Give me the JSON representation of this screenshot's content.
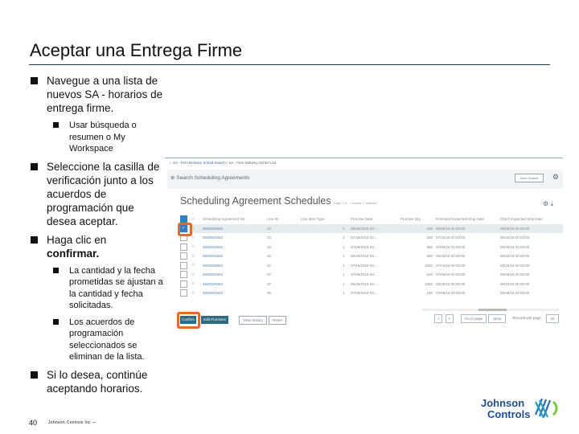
{
  "slide": {
    "title": "Aceptar una Entrega Firme",
    "page_number": "40",
    "footer": "Johnson Controls Inc —",
    "brand": {
      "line1": "Johnson",
      "line2": "Controls",
      "color": "#1f4e8c"
    },
    "rule_color": "#1f3550",
    "highlight_color": "#e46a25"
  },
  "bullets": [
    {
      "text": "Navegue a una lista de nuevos SA - horarios de entrega firme.",
      "sub": [
        {
          "text": "Usar búsqueda o resumen o My Workspace"
        }
      ]
    },
    {
      "text": "Seleccione la casilla de verificación junto a los acuerdos de programación que desea aceptar.",
      "sub": []
    },
    {
      "text_prefix": "Haga clic en",
      "text_bold": "confirmar.",
      "sub": [
        {
          "text": "La cantidad y la fecha prometidas se ajustan a la cantidad y fecha solicitadas."
        },
        {
          "text": "Los acuerdos de programación seleccionados se eliminan de la lista."
        }
      ]
    },
    {
      "text": "Si lo desea, continúe aceptando horarios.",
      "sub": []
    }
  ],
  "screenshot": {
    "breadcrumb": [
      "SA - Firm Delivery Sched Search",
      "SA - Firm Delivery Sched List"
    ],
    "search_label": "Search Scheduling Agreements",
    "save_search": "Save Search",
    "heading": "Scheduling Agreement Schedules",
    "heading_meta": "Page 1 of ... records, 1 selected",
    "columns": [
      "",
      "",
      "Scheduling Agreement No.",
      "Line ID",
      "Line Item Type",
      "",
      "Promise Date",
      "Promise Qty.",
      "Promised Expected Ship Date",
      "OOLT Expected Ship Date"
    ],
    "rows": [
      {
        "checked": true,
        "sa": "5500003563",
        "line": "33",
        "n": "1",
        "pdate": "06/29/2018 03:...",
        "qty": "150",
        "pexp": "06/29/18 00:00:00",
        "oolt": "06/29/18 00:00:00"
      },
      {
        "checked": false,
        "sa": "5500003563",
        "line": "33",
        "n": "1",
        "pdate": "07/18/2018 03:...",
        "qty": "300",
        "pexp": "07/16/18 00:00:00",
        "oolt": "05/15/18 00:00:00"
      },
      {
        "checked": false,
        "sa": "5500003563",
        "line": "33",
        "n": "1",
        "pdate": "07/09/2018 03:...",
        "qty": "350",
        "pexp": "07/09/18 00:00:00",
        "oolt": "05/08/18 00:00:00"
      },
      {
        "checked": false,
        "sa": "5500003563",
        "line": "33",
        "n": "1",
        "pdate": "06/29/2018 03:...",
        "qty": "300",
        "pexp": "06/29/18 00:00:00",
        "oolt": "06/03/18 00:00:00"
      },
      {
        "checked": false,
        "sa": "5500003563",
        "line": "37",
        "n": "1",
        "pdate": "07/16/2018 03:...",
        "qty": "1050",
        "pexp": "07/16/18 00:00:00",
        "oolt": "05/15/18 00:00:00"
      },
      {
        "checked": false,
        "sa": "5500003563",
        "line": "37",
        "n": "1",
        "pdate": "07/09/2018 03:...",
        "qty": "520",
        "pexp": "07/09/18 00:00:00",
        "oolt": "05/08/18 00:00:00"
      },
      {
        "checked": false,
        "sa": "5500003563",
        "line": "37",
        "n": "1",
        "pdate": "06/29/2018 03:...",
        "qty": "1050",
        "pexp": "06/29/18 00:00:00",
        "oolt": "06/03/18 00:00:00"
      },
      {
        "checked": false,
        "sa": "5500003563",
        "line": "35",
        "n": "1",
        "pdate": "07/09/2018 03:...",
        "qty": "180",
        "pexp": "07/09/18 00:00:00",
        "oolt": "05/08/18 00:00:00"
      }
    ],
    "buttons": {
      "confirm": "Confirm",
      "edit_promises": "Edit Promises",
      "view_history": "View History",
      "reset": "Reset"
    },
    "pagination": {
      "prev": "<",
      "next": ">",
      "goto_placeholder": "Go to page",
      "jump": "Jump",
      "records_label": "Records per page",
      "records_value": "20"
    }
  }
}
